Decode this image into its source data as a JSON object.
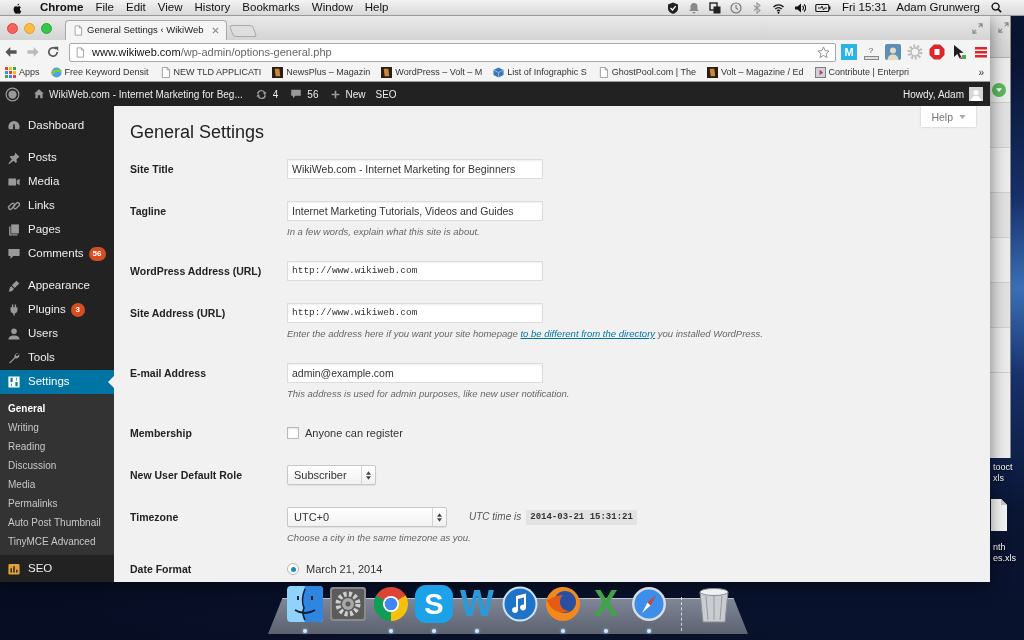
{
  "menu_bar": {
    "app_name": "Chrome",
    "menus": [
      "File",
      "Edit",
      "View",
      "History",
      "Bookmarks",
      "Window",
      "Help"
    ],
    "status_icons": [
      {
        "kind": "shield"
      },
      {
        "kind": "bell"
      },
      {
        "kind": "squares"
      },
      {
        "kind": "clock"
      },
      {
        "kind": "bluetooth"
      },
      {
        "kind": "wifi"
      },
      {
        "kind": "volume"
      },
      {
        "kind": "battery"
      }
    ],
    "clock": "Fri 15:31",
    "user": "Adam Grunwerg"
  },
  "browser": {
    "tabs": [
      {
        "title": "General Settings ‹ WikiWeb",
        "selected": true
      }
    ],
    "url": {
      "host": "www.wikiweb.com",
      "path": "/wp-admin/options-general.php"
    },
    "extensions": [
      {
        "kind": "letter_tile",
        "glyph": "M"
      },
      {
        "kind": "scale",
        "glyph": "?"
      },
      {
        "kind": "portrait"
      },
      {
        "kind": "gear"
      },
      {
        "kind": "stop"
      },
      {
        "kind": "cursor"
      }
    ],
    "bookmarks": [
      {
        "kind": "apps",
        "label": "Apps"
      },
      {
        "kind": "globe",
        "label": "Free Keyword Densit"
      },
      {
        "kind": "page",
        "label": "NEW TLD APPLICATI"
      },
      {
        "kind": "thumb",
        "label": "NewsPlus – Magazin"
      },
      {
        "kind": "thumb",
        "label": "WordPress – Volt – M"
      },
      {
        "kind": "cube",
        "label": "List of Infographic S"
      },
      {
        "kind": "page",
        "label": "GhostPool.com | The"
      },
      {
        "kind": "thumb",
        "label": "Volt – Magazine / Ed"
      },
      {
        "kind": "arrow_tile",
        "label": "Contribute | Enterpri"
      }
    ],
    "bookmarks_overflow": "»"
  },
  "admin_bar": {
    "site_name": "WikiWeb.com - Internet Marketing for Beg...",
    "updates": "4",
    "comments": "56",
    "new": "New",
    "seo": "SEO",
    "greeting": "Howdy, Adam"
  },
  "sidebar": {
    "groups": [
      [
        {
          "kind": "dashboard",
          "label": "Dashboard",
          "selected": false
        }
      ],
      [
        {
          "kind": "posts",
          "label": "Posts",
          "selected": false
        },
        {
          "kind": "media",
          "label": "Media",
          "selected": false
        },
        {
          "kind": "links",
          "label": "Links",
          "selected": false
        },
        {
          "kind": "pages",
          "label": "Pages",
          "selected": false
        },
        {
          "kind": "comments",
          "label": "Comments",
          "selected": false,
          "badge": "56"
        }
      ],
      [
        {
          "kind": "appearance",
          "label": "Appearance",
          "selected": false
        },
        {
          "kind": "plugins",
          "label": "Plugins",
          "selected": false,
          "badge": "3"
        },
        {
          "kind": "users",
          "label": "Users",
          "selected": false
        },
        {
          "kind": "tools",
          "label": "Tools",
          "selected": false
        },
        {
          "kind": "settings",
          "label": "Settings",
          "selected": true,
          "children": [
            {
              "label": "General",
              "selected": true
            },
            {
              "label": "Writing",
              "selected": false
            },
            {
              "label": "Reading",
              "selected": false
            },
            {
              "label": "Discussion",
              "selected": false
            },
            {
              "label": "Media",
              "selected": false
            },
            {
              "label": "Permalinks",
              "selected": false
            },
            {
              "label": "Auto Post Thumbnail",
              "selected": false
            },
            {
              "label": "TinyMCE Advanced",
              "selected": false
            }
          ]
        }
      ],
      [
        {
          "kind": "seo",
          "label": "SEO",
          "selected": false
        }
      ]
    ]
  },
  "page": {
    "title": "General Settings",
    "help_tab": "Help",
    "fields": [
      {
        "kind": "text",
        "label": "Site Title",
        "value": "WikiWeb.com - Internet Marketing for Beginners"
      },
      {
        "kind": "text",
        "label": "Tagline",
        "value": "Internet Marketing Tutorials, Videos and Guides",
        "description": "In a few words, explain what this site is about."
      },
      {
        "kind": "url",
        "label": "WordPress Address (URL)",
        "value": "http://www.wikiweb.com"
      },
      {
        "kind": "url",
        "label": "Site Address (URL)",
        "value": "http://www.wikiweb.com",
        "description": "Enter the address here if you want your site homepage",
        "description_link": "to be different from the directory",
        "description_end": "you installed WordPress."
      },
      {
        "kind": "email",
        "label": "E-mail Address",
        "value": "admin@example.com",
        "description": "This address is used for admin purposes, like new user notification."
      },
      {
        "kind": "checkbox",
        "label": "Membership",
        "option": "Anyone can register",
        "checked": false
      },
      {
        "kind": "select",
        "label": "New User Default Role",
        "value": "Subscriber"
      },
      {
        "kind": "timezone",
        "label": "Timezone",
        "value": "UTC+0",
        "note": "UTC time is",
        "time": "2014-03-21 15:31:21",
        "description": "Choose a city in the same timezone as you."
      },
      {
        "kind": "radio",
        "label": "Date Format",
        "options": [
          {
            "label": "March 21, 2014",
            "selected": true
          }
        ]
      }
    ]
  },
  "desktop": {
    "files": [
      {
        "kind": "label",
        "label_lines": [
          "tooct",
          "xls"
        ]
      },
      {
        "kind": "document",
        "label_lines": [
          "nth",
          "es.xls"
        ]
      }
    ]
  },
  "dock": {
    "items": [
      {
        "kind": "finder",
        "running": true
      },
      {
        "kind": "gear",
        "running": false
      },
      {
        "kind": "chrome",
        "running": true
      },
      {
        "kind": "tile_letter",
        "glyph": "S",
        "running": true
      },
      {
        "kind": "letter",
        "glyph": "W",
        "color": "#2c9ad8",
        "running": true
      },
      {
        "kind": "note",
        "running": false
      },
      {
        "kind": "fox",
        "running": true
      },
      {
        "kind": "letter",
        "glyph": "X",
        "color": "#3fa447",
        "running": true
      },
      {
        "kind": "compass",
        "running": true
      },
      {
        "kind": "trash",
        "running": false
      }
    ]
  }
}
